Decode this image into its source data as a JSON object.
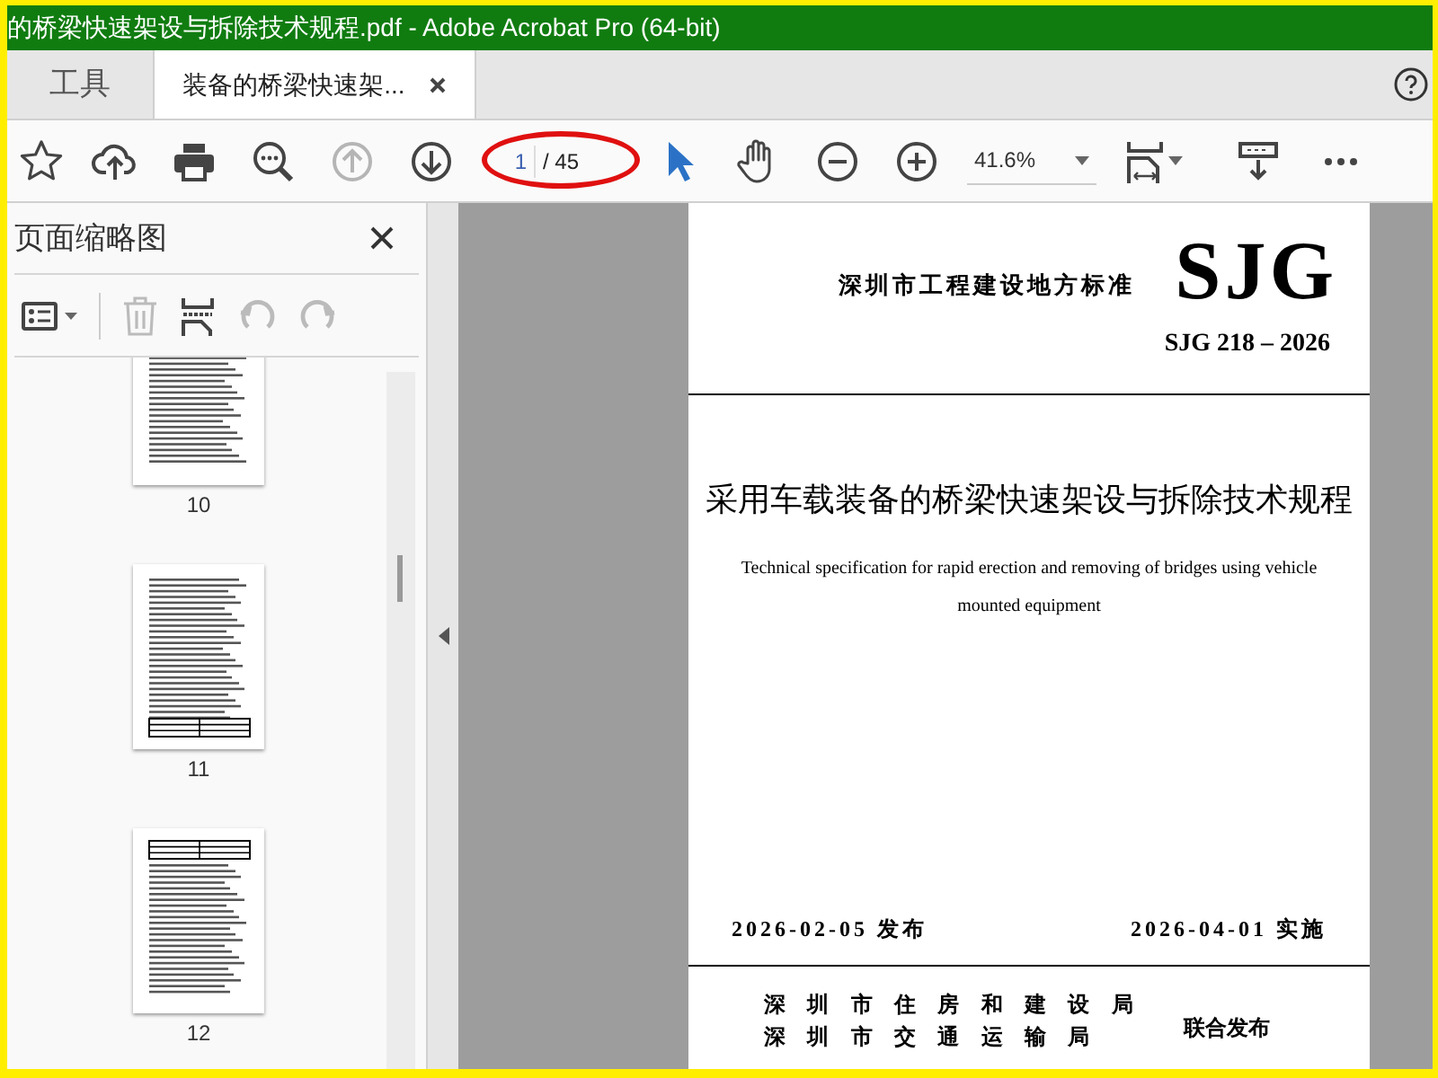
{
  "window": {
    "title": "的桥梁快速架设与拆除技术规程.pdf - Adobe Acrobat Pro (64-bit)"
  },
  "tabs": [
    {
      "label": "工具",
      "selected": false,
      "closable": false
    },
    {
      "label": "装备的桥梁快速架...",
      "selected": true,
      "closable": true
    }
  ],
  "toolbar": {
    "page_number": "1",
    "page_total": "/ 45",
    "zoom": "41.6%"
  },
  "sidebar": {
    "title": "页面缩略图",
    "thumbnails": [
      {
        "label": "10",
        "kind": "text"
      },
      {
        "label": "11",
        "kind": "table-bottom"
      },
      {
        "label": "12",
        "kind": "table-top"
      }
    ]
  },
  "document": {
    "series": "深圳市工程建设地方标准",
    "logo": "SJG",
    "code": "SJG 218 – 2026",
    "title": "采用车载装备的桥梁快速架设与拆除技术规程",
    "subtitle": "Technical specification for rapid erection and removing of bridges using vehicle mounted equipment",
    "issued": "2026-02-05 发布",
    "effective": "2026-04-01 实施",
    "issuers": [
      "深 圳 市 住 房 和 建 设 局",
      "深 圳 市 交 通 运 输 局"
    ],
    "joint": "联合发布"
  }
}
